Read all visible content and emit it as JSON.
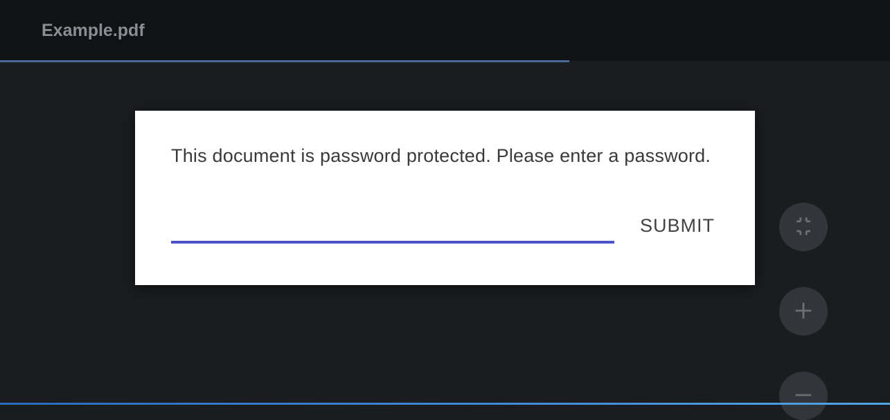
{
  "header": {
    "title": "Example.pdf"
  },
  "dialog": {
    "message": "This document is password protected. Please enter a password.",
    "submit_label": "SUBMIT",
    "password_value": ""
  },
  "controls": {
    "fit_label": "fit-to-page-icon",
    "zoom_in_label": "zoom-in-icon",
    "zoom_out_label": "zoom-out-icon"
  }
}
